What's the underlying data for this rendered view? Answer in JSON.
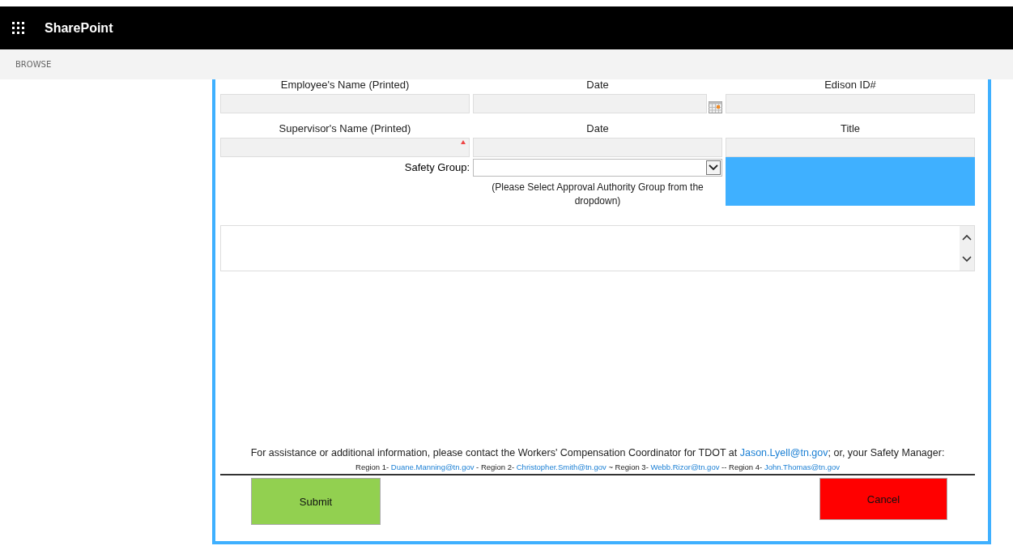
{
  "header": {
    "app_name": "SharePoint"
  },
  "ribbon": {
    "tab": "BROWSE"
  },
  "form": {
    "rows": [
      {
        "fields": [
          {
            "label": "Employee's Name (Printed)",
            "kind": "text",
            "required": false
          },
          {
            "label": "Date",
            "kind": "date",
            "required": false
          },
          {
            "label": "Edison ID#",
            "kind": "text",
            "required": false
          }
        ]
      },
      {
        "fields": [
          {
            "label": "Supervisor's Name (Printed)",
            "kind": "text",
            "required": true
          },
          {
            "label": "Date",
            "kind": "text",
            "required": false
          },
          {
            "label": "Title",
            "kind": "text",
            "required": false
          }
        ]
      }
    ],
    "safety_group": {
      "label": "Safety Group:",
      "hint": "(Please Select Approval Authority Group from the dropdown)"
    },
    "footer": {
      "contact": [
        {
          "kind": "text",
          "text": "For assistance or additional information, please contact the Workers' Compensation Coordinator for TDOT at "
        },
        {
          "kind": "link",
          "text": "Jason.Lyell@tn.gov"
        },
        {
          "kind": "text",
          "text": "; or, your Safety Manager:"
        }
      ],
      "regions": [
        {
          "kind": "text",
          "text": "Region 1- "
        },
        {
          "kind": "link",
          "text": "Duane.Manning@tn.gov"
        },
        {
          "kind": "text",
          "text": " - Region 2- "
        },
        {
          "kind": "link",
          "text": "Christopher.Smith@tn.gov"
        },
        {
          "kind": "text",
          "text": " ~ Region 3- "
        },
        {
          "kind": "link",
          "text": "Webb.Rizor@tn.gov"
        },
        {
          "kind": "text",
          "text": " -- Region 4- "
        },
        {
          "kind": "link",
          "text": "John.Thomas@tn.gov"
        }
      ]
    },
    "buttons": [
      {
        "label": "Submit",
        "kind": "submit"
      },
      {
        "label": "Cancel",
        "kind": "cancel"
      }
    ]
  }
}
